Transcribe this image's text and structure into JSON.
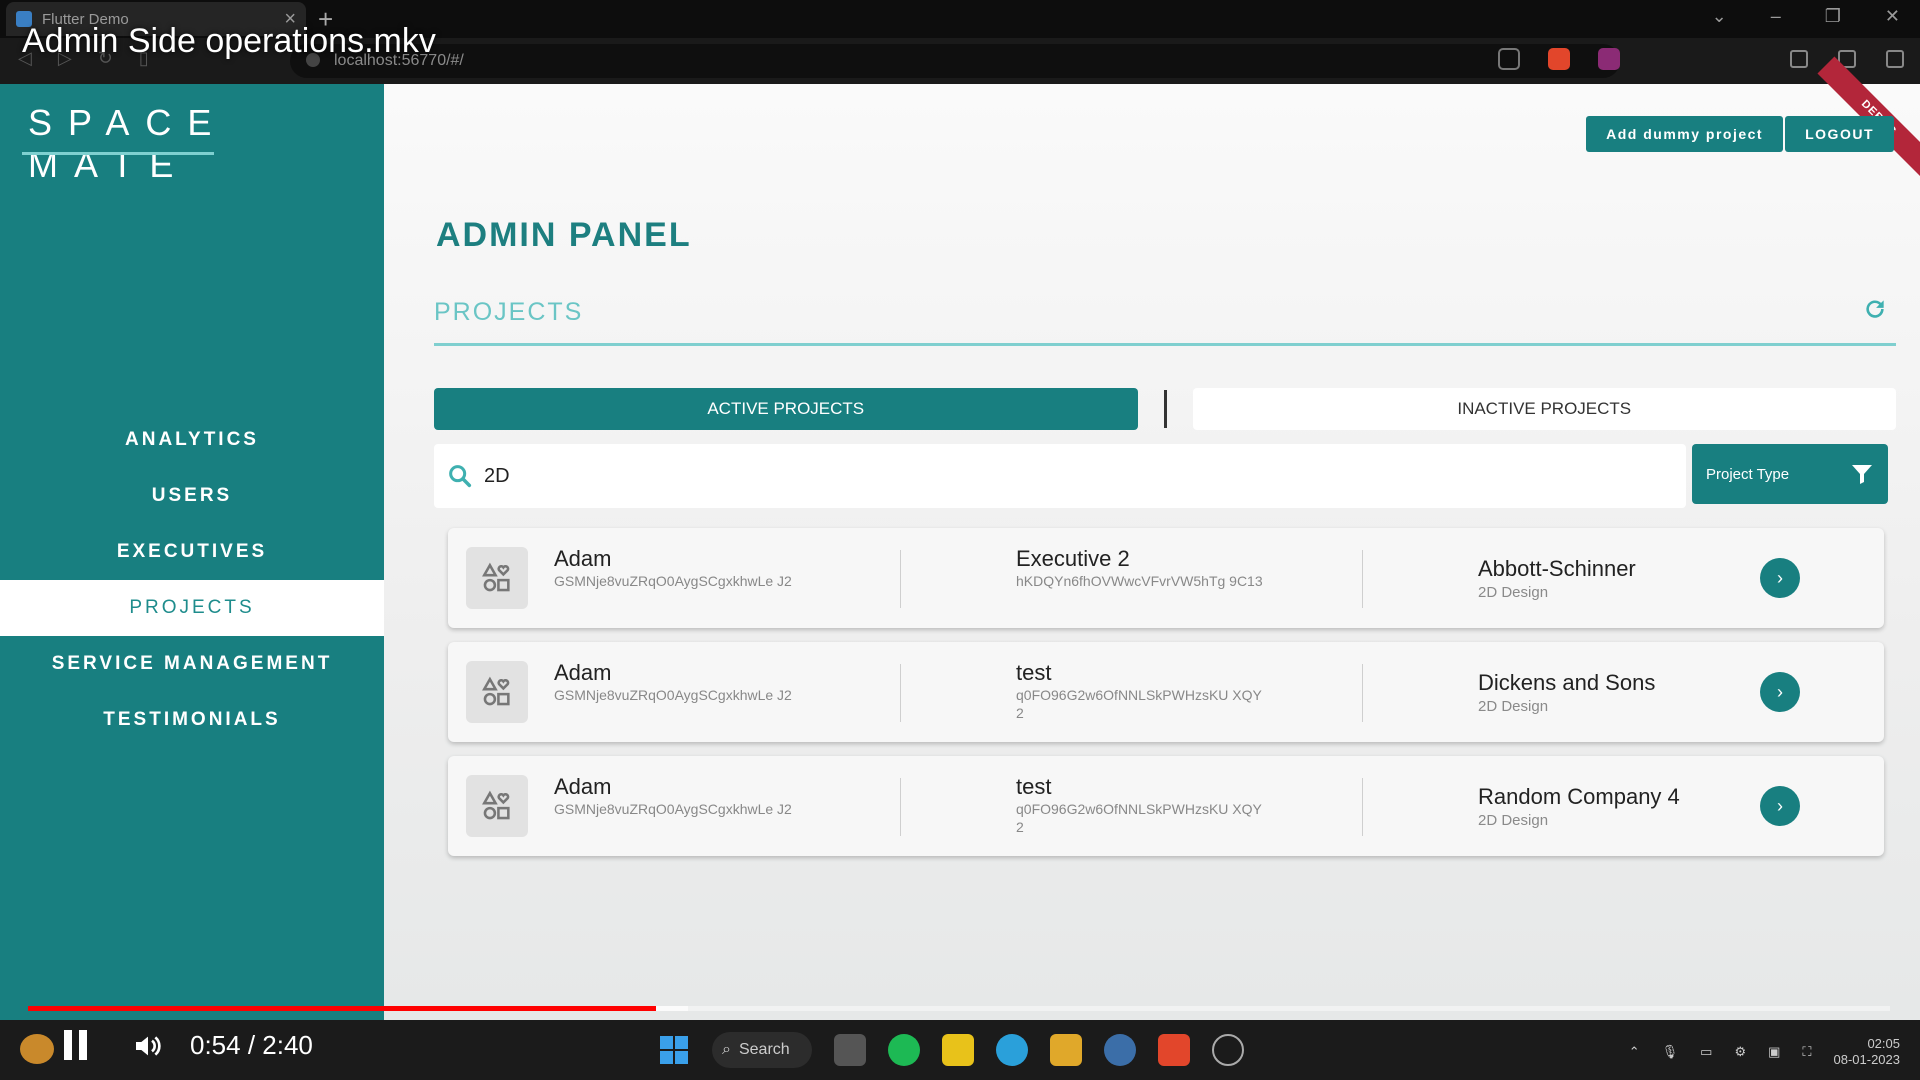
{
  "browser": {
    "tab_title": "Flutter Demo",
    "url": "localhost:56770/#/"
  },
  "video": {
    "title": "Admin Side operations.mkv",
    "time": "0:54 / 2:40",
    "progress_fraction": 0.3375
  },
  "sidebar": {
    "logo": "SPACE MATE",
    "items": [
      {
        "label": "ANALYTICS",
        "active": false
      },
      {
        "label": "USERS",
        "active": false
      },
      {
        "label": "EXECUTIVES",
        "active": false
      },
      {
        "label": "PROJECTS",
        "active": true
      },
      {
        "label": "SERVICE MANAGEMENT",
        "active": false
      },
      {
        "label": "TESTIMONIALS",
        "active": false
      }
    ]
  },
  "header": {
    "add_dummy_label": "Add dummy project",
    "logout_label": "LOGOUT",
    "debug_label": "DEBUG"
  },
  "main": {
    "title": "ADMIN PANEL",
    "section_title": "PROJECTS",
    "tabs": {
      "active_label": "ACTIVE PROJECTS",
      "inactive_label": "INACTIVE PROJECTS"
    },
    "search": {
      "value": "2D"
    },
    "filter_label": "Project Type"
  },
  "projects": [
    {
      "user_name": "Adam",
      "user_id": "GSMNje8vuZRqO0AygSCgxkhwLe J2",
      "executive_name": "Executive 2",
      "executive_id": "hKDQYn6fhOVWwcVFvrVW5hTg 9C13",
      "company": "Abbott-Schinner",
      "type": "2D Design"
    },
    {
      "user_name": "Adam",
      "user_id": "GSMNje8vuZRqO0AygSCgxkhwLe J2",
      "executive_name": "test",
      "executive_id": "q0FO96G2w6OfNNLSkPWHzsKU XQY2",
      "company": "Dickens and Sons",
      "type": "2D Design"
    },
    {
      "user_name": "Adam",
      "user_id": "GSMNje8vuZRqO0AygSCgxkhwLe J2",
      "executive_name": "test",
      "executive_id": "q0FO96G2w6OfNNLSkPWHzsKU XQY2",
      "company": "Random Company 4",
      "type": "2D Design"
    }
  ],
  "taskbar": {
    "search_label": "Search",
    "clock_time": "02:05",
    "clock_date": "08-01-2023"
  },
  "colors": {
    "brand_teal": "#187f80",
    "accent_light_teal": "#6ac5c5",
    "progress_red": "#ff0000"
  }
}
